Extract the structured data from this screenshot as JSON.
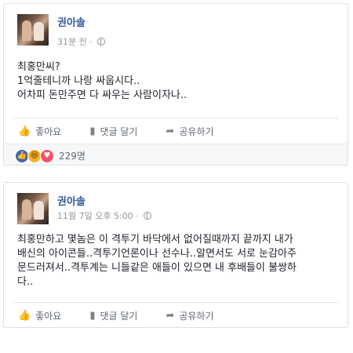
{
  "posts": [
    {
      "author": "권아솔",
      "time": "31분 전",
      "lines": [
        "최홍만씨?",
        "1억줄테니까 나랑 싸웁시다..",
        "어차피 돈만주면 다 싸우는 사람이자나.."
      ],
      "actions": {
        "like": "좋아요",
        "comment": "댓글 달기",
        "share": "공유하기"
      },
      "reaction_count": "229명"
    },
    {
      "author": "권아솔",
      "time": "11월 7일 오후 5:00",
      "lines": [
        "최홍만하고 몇놈은 이 격투기 바닥에서 없어질때까지 끝까지 내가",
        "배신의 아이콘들..격투기언론이나 선수나..알면서도 서로 눈감아주",
        "문드러져서..격투계는 니들같은 애들이 있으면 내 후배들이 불쌍하",
        "다.."
      ],
      "actions": {
        "like": "좋아요",
        "comment": "댓글 달기",
        "share": "공유하기"
      }
    }
  ],
  "icons": {
    "like": "thumbs-up-icon",
    "comment": "speech-bubble-icon",
    "share": "share-arrow-icon",
    "privacy": "globe-icon"
  },
  "colors": {
    "author": "#365899",
    "meta": "#90949c",
    "reaction_like": "#4267b2",
    "reaction_haha": "#f7b125",
    "reaction_love": "#f25268"
  }
}
